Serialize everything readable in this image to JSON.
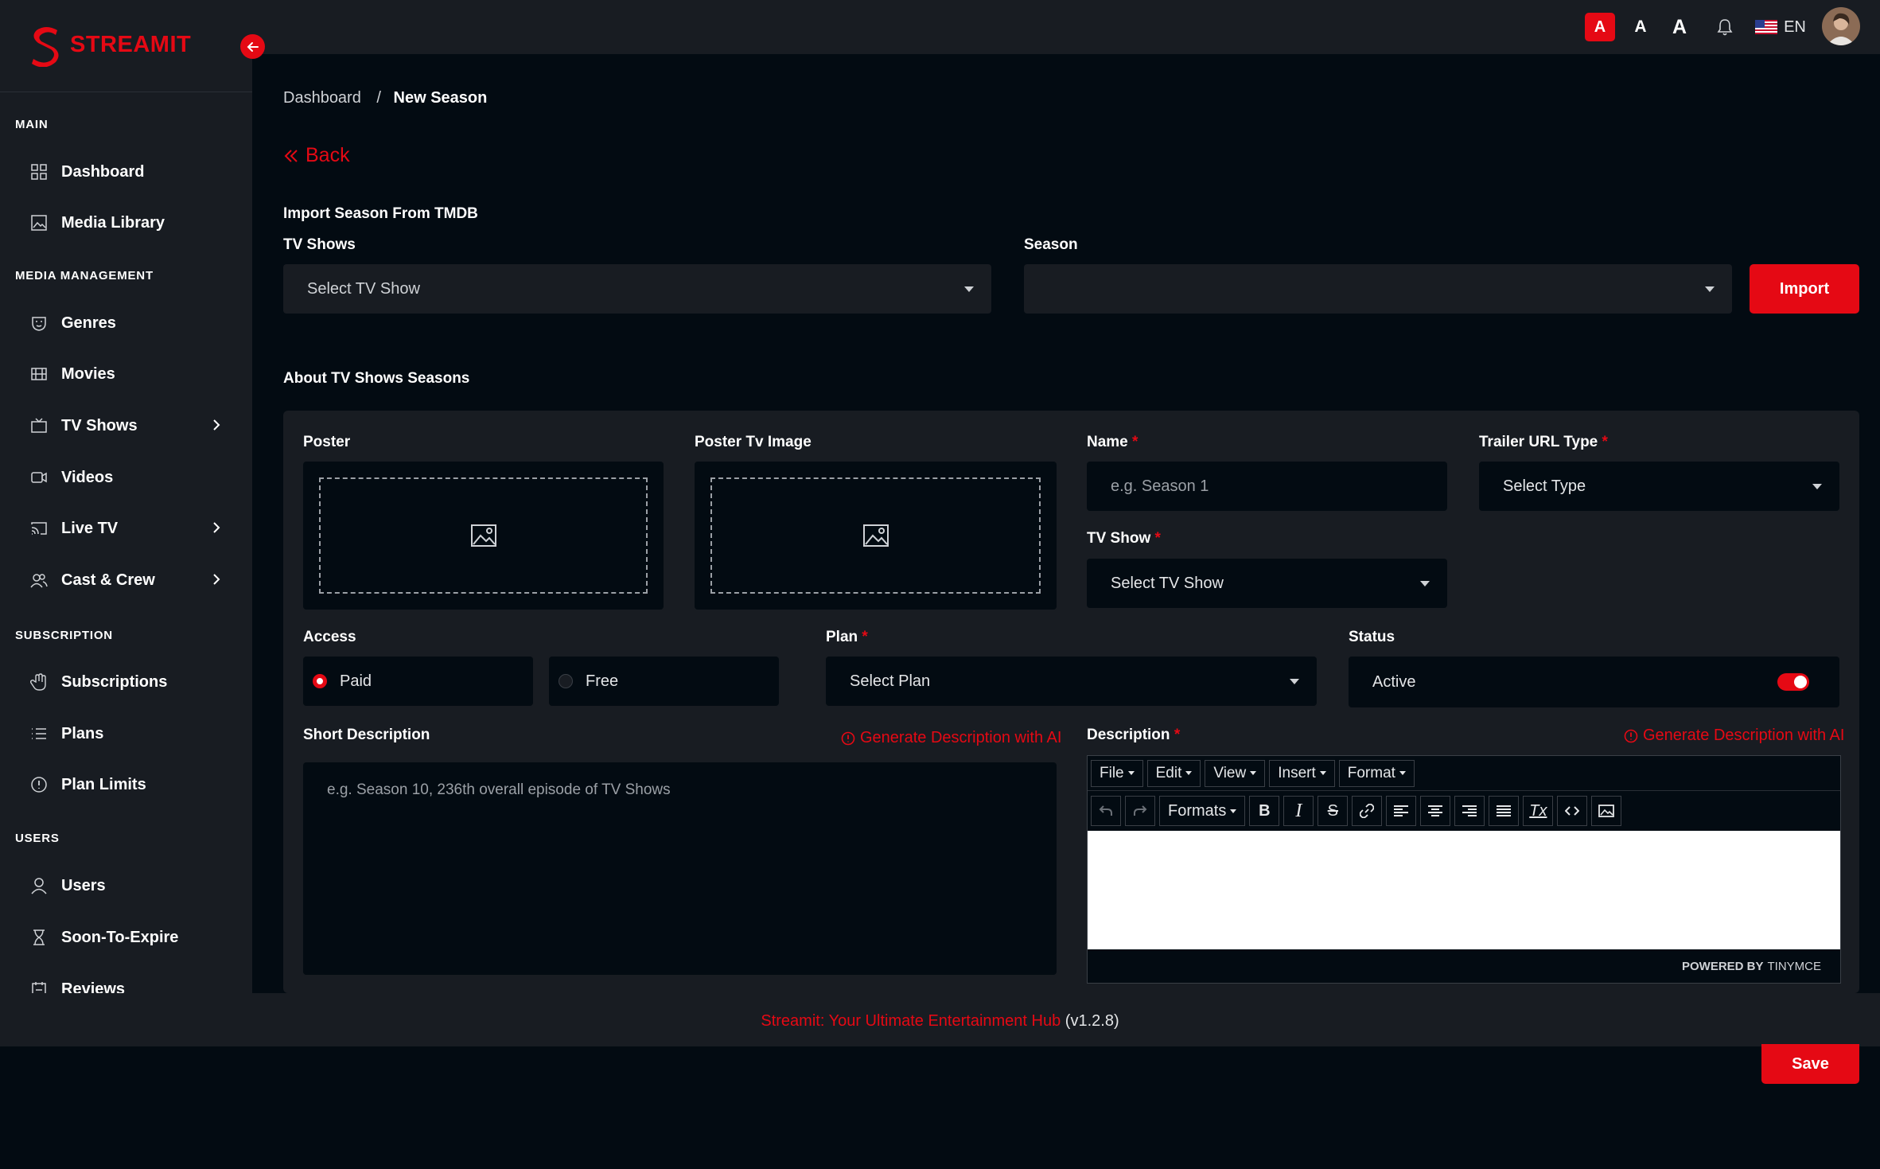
{
  "brand": {
    "name": "STREAMIT"
  },
  "colors": {
    "accent": "#e50914",
    "panel": "#181c22",
    "background": "#030b12"
  },
  "sidebar": {
    "sections": [
      {
        "title": "MAIN",
        "items": [
          {
            "label": "Dashboard",
            "icon": "grid-icon"
          },
          {
            "label": "Media Library",
            "icon": "image-icon"
          }
        ]
      },
      {
        "title": "MEDIA MANAGEMENT",
        "items": [
          {
            "label": "Genres",
            "icon": "mask-icon"
          },
          {
            "label": "Movies",
            "icon": "film-icon"
          },
          {
            "label": "TV Shows",
            "icon": "tv-icon",
            "expandable": true
          },
          {
            "label": "Videos",
            "icon": "video-icon"
          },
          {
            "label": "Live TV",
            "icon": "cast-icon",
            "expandable": true
          },
          {
            "label": "Cast & Crew",
            "icon": "people-icon",
            "expandable": true
          }
        ]
      },
      {
        "title": "SUBSCRIPTION",
        "items": [
          {
            "label": "Subscriptions",
            "icon": "hand-icon"
          },
          {
            "label": "Plans",
            "icon": "list-icon"
          },
          {
            "label": "Plan Limits",
            "icon": "info-icon"
          }
        ]
      },
      {
        "title": "USERS",
        "items": [
          {
            "label": "Users",
            "icon": "user-icon"
          },
          {
            "label": "Soon-To-Expire",
            "icon": "hourglass-icon"
          },
          {
            "label": "Reviews",
            "icon": "review-icon"
          }
        ]
      }
    ]
  },
  "topbar": {
    "font_sizes": [
      "A",
      "A",
      "A"
    ],
    "language": "EN"
  },
  "breadcrumb": {
    "root": "Dashboard",
    "separator": "/",
    "current": "New Season"
  },
  "back_label": "Back",
  "import": {
    "heading": "Import Season From TMDB",
    "tv_shows_label": "TV Shows",
    "tv_shows_placeholder": "Select TV Show",
    "season_label": "Season",
    "season_value": "",
    "button": "Import"
  },
  "about_heading": "About TV Shows Seasons",
  "form": {
    "poster_label": "Poster",
    "poster_tv_label": "Poster Tv Image",
    "name_label": "Name",
    "name_placeholder": "e.g. Season 1",
    "trailer_label": "Trailer URL Type",
    "trailer_placeholder": "Select Type",
    "tv_show_label": "TV Show",
    "tv_show_placeholder": "Select TV Show",
    "access_label": "Access",
    "access_options": [
      {
        "label": "Paid",
        "selected": true
      },
      {
        "label": "Free",
        "selected": false
      }
    ],
    "plan_label": "Plan",
    "plan_placeholder": "Select Plan",
    "status_label": "Status",
    "status_value": "Active",
    "status_on": true,
    "short_desc_label": "Short Description",
    "short_desc_placeholder": "e.g. Season 10, 236th overall episode of TV Shows",
    "ai_link": "Generate Description with AI",
    "desc_label": "Description",
    "required_mark": "*"
  },
  "editor": {
    "menus": [
      "File",
      "Edit",
      "View",
      "Insert",
      "Format"
    ],
    "formats_label": "Formats",
    "powered_by": "POWERED BY",
    "powered_brand": "TINYMCE"
  },
  "footer": {
    "brand_text": "Streamit: Your Ultimate Entertainment Hub",
    "version": "(v1.2.8)"
  },
  "save_button": "Save"
}
